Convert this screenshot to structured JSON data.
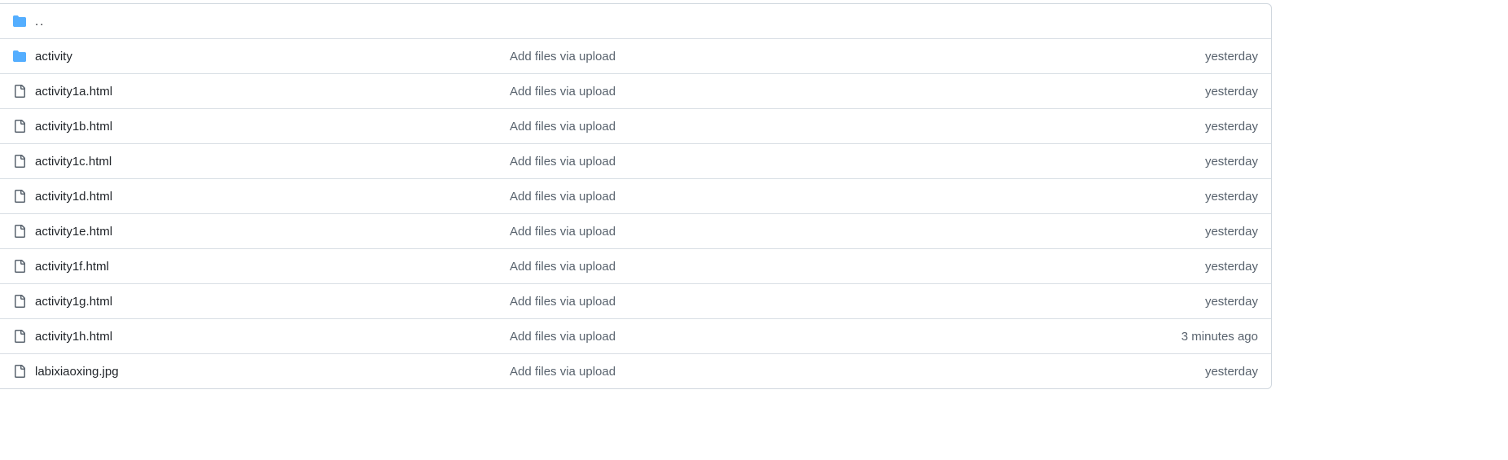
{
  "colors": {
    "folder_icon": "#54aeff",
    "file_icon": "#59636e",
    "border": "#d0d7de",
    "muted_text": "#59636e",
    "text": "#1f2328"
  },
  "file_list": {
    "parent_dir": {
      "label": "..",
      "icon": "folder-icon"
    },
    "rows": [
      {
        "name": "activity",
        "type": "folder",
        "icon": "folder-icon",
        "commit_message": "Add files via upload",
        "age": "yesterday"
      },
      {
        "name": "activity1a.html",
        "type": "file",
        "icon": "file-icon",
        "commit_message": "Add files via upload",
        "age": "yesterday"
      },
      {
        "name": "activity1b.html",
        "type": "file",
        "icon": "file-icon",
        "commit_message": "Add files via upload",
        "age": "yesterday"
      },
      {
        "name": "activity1c.html",
        "type": "file",
        "icon": "file-icon",
        "commit_message": "Add files via upload",
        "age": "yesterday"
      },
      {
        "name": "activity1d.html",
        "type": "file",
        "icon": "file-icon",
        "commit_message": "Add files via upload",
        "age": "yesterday"
      },
      {
        "name": "activity1e.html",
        "type": "file",
        "icon": "file-icon",
        "commit_message": "Add files via upload",
        "age": "yesterday"
      },
      {
        "name": "activity1f.html",
        "type": "file",
        "icon": "file-icon",
        "commit_message": "Add files via upload",
        "age": "yesterday"
      },
      {
        "name": "activity1g.html",
        "type": "file",
        "icon": "file-icon",
        "commit_message": "Add files via upload",
        "age": "yesterday"
      },
      {
        "name": "activity1h.html",
        "type": "file",
        "icon": "file-icon",
        "commit_message": "Add files via upload",
        "age": "3 minutes ago"
      },
      {
        "name": "labixiaoxing.jpg",
        "type": "file",
        "icon": "file-icon",
        "commit_message": "Add files via upload",
        "age": "yesterday"
      }
    ]
  }
}
